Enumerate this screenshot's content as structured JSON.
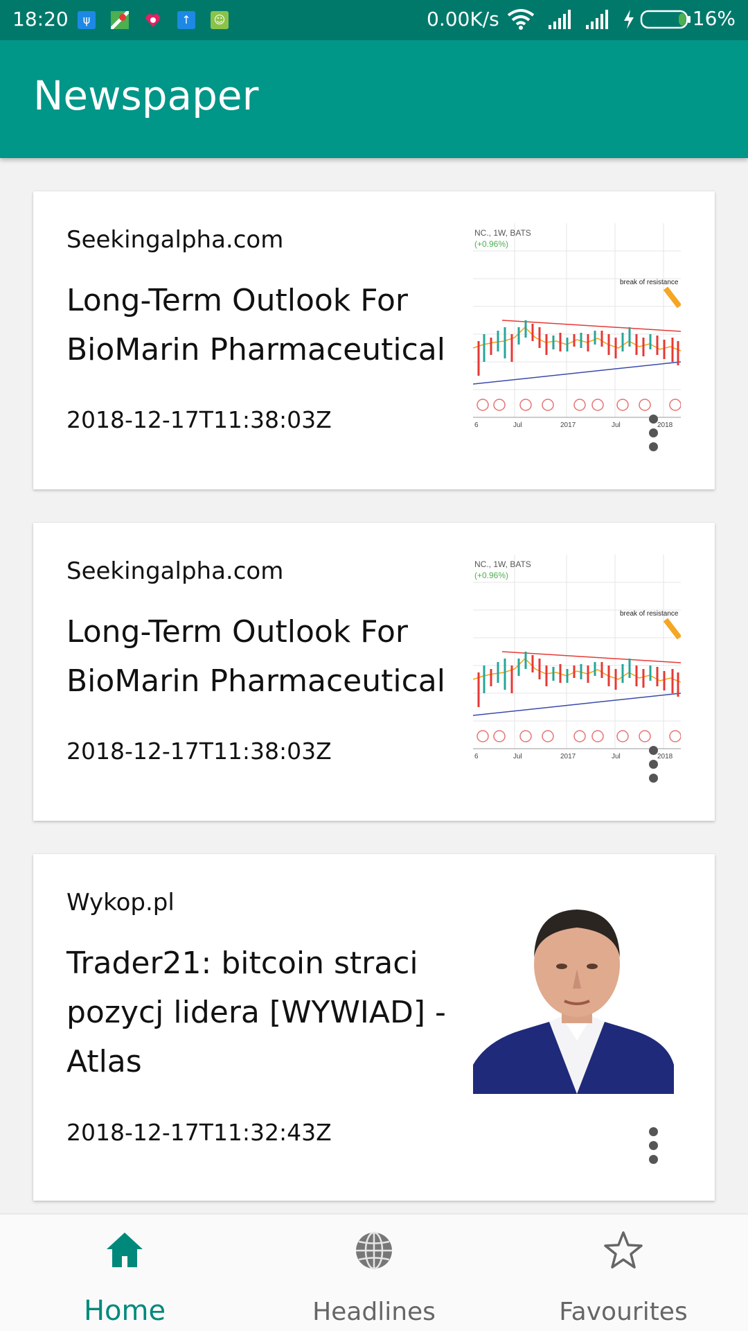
{
  "status_bar": {
    "time": "18:20",
    "net_speed": "0.00K/s",
    "battery": "16%",
    "icons": [
      "usb-icon",
      "maps-icon",
      "health-icon",
      "upload-icon",
      "android-icon",
      "wifi-icon",
      "signal-icon",
      "signal-icon",
      "charging-icon",
      "battery-icon"
    ]
  },
  "app_bar": {
    "title": "Newspaper"
  },
  "articles": [
    {
      "source": "Seekingalpha.com",
      "headline": "Long-Term Outlook For BioMarin Pharmaceutical",
      "date": "2018-12-17T11:38:03Z",
      "thumb_type": "chart",
      "chart_texts": {
        "header": "NC., 1W, BATS",
        "change": "(+0.96%)",
        "annotation": "break of resistance",
        "ticks": [
          "6",
          "Jul",
          "2017",
          "Jul",
          "2018"
        ]
      }
    },
    {
      "source": "Seekingalpha.com",
      "headline": "Long-Term Outlook For BioMarin Pharmaceutical",
      "date": "2018-12-17T11:38:03Z",
      "thumb_type": "chart",
      "chart_texts": {
        "header": "NC., 1W, BATS",
        "change": "(+0.96%)",
        "annotation": "break of resistance",
        "ticks": [
          "6",
          "Jul",
          "2017",
          "Jul",
          "2018"
        ]
      }
    },
    {
      "source": "Wykop.pl",
      "headline": "Trader21: bitcoin straci pozycj  lidera [WYWIAD] - Atlas",
      "date": "2018-12-17T11:32:43Z",
      "thumb_type": "photo"
    }
  ],
  "bottom_nav": {
    "items": [
      {
        "label": "Home",
        "icon": "home-icon",
        "active": true
      },
      {
        "label": "Headlines",
        "icon": "globe-icon",
        "active": false
      },
      {
        "label": "Favourites",
        "icon": "star-icon",
        "active": false
      }
    ],
    "active_color": "#00897b",
    "inactive_color": "#666666"
  },
  "colors": {
    "primary": "#009688",
    "primary_dark": "#00796b"
  }
}
